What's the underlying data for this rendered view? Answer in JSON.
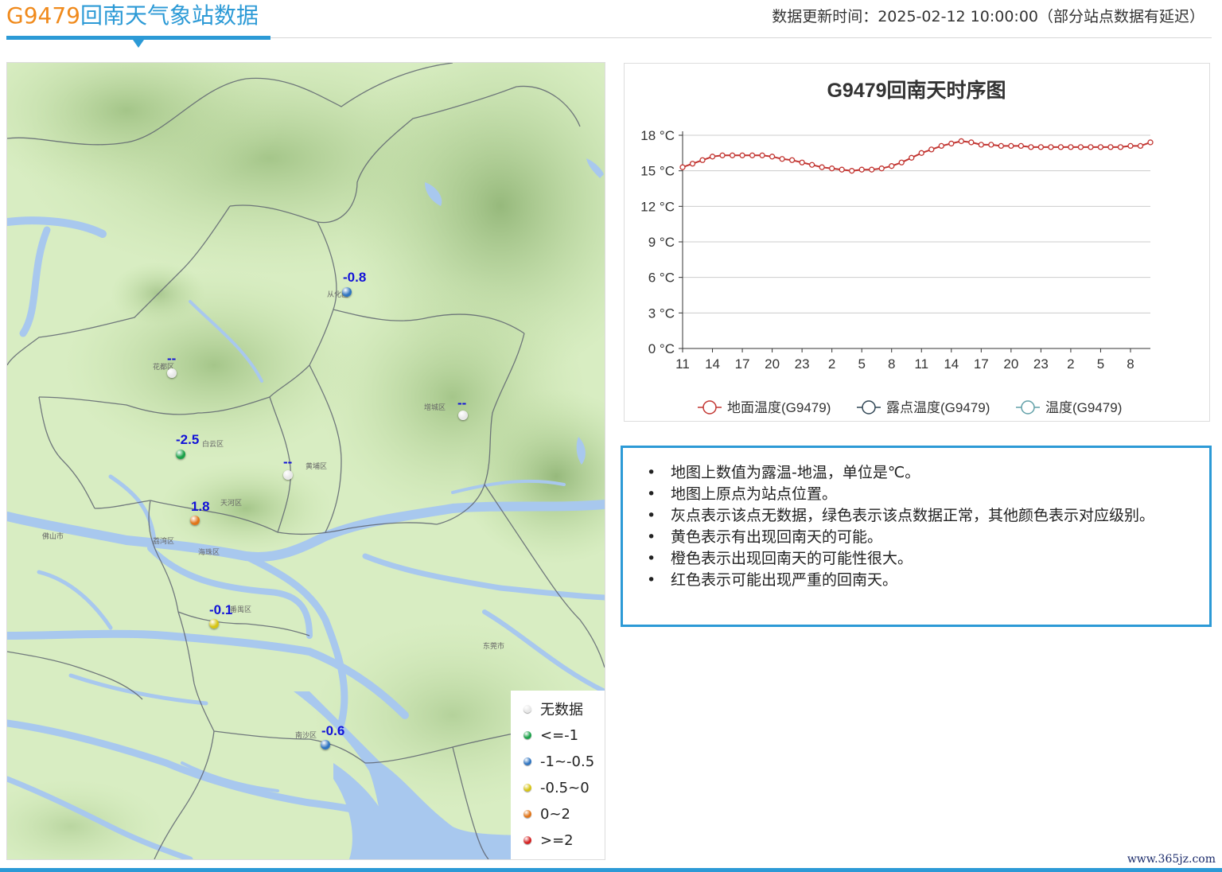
{
  "header": {
    "station_id": "G9479",
    "title_suffix": "回南天气象站数据",
    "update_text": "数据更新时间：2025-02-12 10:00:00（部分站点数据有延迟）"
  },
  "map": {
    "stations": [
      {
        "value": "-0.8",
        "color": "#2f74c0"
      },
      {
        "value": "--",
        "color": "#e8e8e8"
      },
      {
        "value": "--",
        "color": "#e8e8e8"
      },
      {
        "value": "-2.5",
        "color": "#1aa048"
      },
      {
        "value": "--",
        "color": "#e8e8e8"
      },
      {
        "value": "1.8",
        "color": "#e07418"
      },
      {
        "value": "-0.1",
        "color": "#d6c414"
      },
      {
        "value": "-0.6",
        "color": "#2f74c0"
      }
    ],
    "place_labels": [
      "花都区",
      "从化区",
      "白云区",
      "增城区",
      "天河区",
      "番禺区",
      "南沙区",
      "东莞市",
      "佛山市",
      "荔湾区",
      "海珠区",
      "黄埔区"
    ],
    "legend": [
      {
        "label": "无数据",
        "color": "#e8e8e8"
      },
      {
        "label": "<=-1",
        "color": "#1aa048"
      },
      {
        "label": "-1~-0.5",
        "color": "#2f74c0"
      },
      {
        "label": "-0.5~0",
        "color": "#d6c414"
      },
      {
        "label": "0~2",
        "color": "#e07418"
      },
      {
        "label": ">=2",
        "color": "#d42020"
      }
    ]
  },
  "chart_data": {
    "type": "line",
    "title": "G9479回南天时序图",
    "x": [
      "11",
      "12",
      "13",
      "14",
      "15",
      "16",
      "17",
      "18",
      "19",
      "20",
      "21",
      "22",
      "23",
      "0",
      "1",
      "2",
      "3",
      "4",
      "5",
      "6",
      "7",
      "8",
      "9",
      "10",
      "11",
      "12",
      "13",
      "14",
      "15",
      "16",
      "17",
      "18",
      "19",
      "20",
      "21",
      "22",
      "23",
      "0",
      "1",
      "2",
      "3",
      "4",
      "5",
      "6",
      "7",
      "8",
      "9",
      "10"
    ],
    "x_tick_labels": [
      "11",
      "14",
      "17",
      "20",
      "23",
      "2",
      "5",
      "8",
      "11",
      "14",
      "17",
      "20",
      "23",
      "2",
      "5",
      "8"
    ],
    "y_tick_labels": [
      "0 °C",
      "3 °C",
      "6 °C",
      "9 °C",
      "12 °C",
      "15 °C",
      "18 °C"
    ],
    "ylim": [
      0,
      18
    ],
    "grid": true,
    "legend_position": "bottom",
    "series": [
      {
        "name": "地面温度(G9479)",
        "color": "#c23531",
        "values": [
          15.3,
          15.6,
          15.9,
          16.2,
          16.3,
          16.3,
          16.3,
          16.3,
          16.3,
          16.2,
          16.0,
          15.9,
          15.7,
          15.5,
          15.3,
          15.2,
          15.1,
          15.0,
          15.1,
          15.1,
          15.2,
          15.4,
          15.7,
          16.1,
          16.5,
          16.8,
          17.1,
          17.3,
          17.5,
          17.4,
          17.2,
          17.2,
          17.1,
          17.1,
          17.1,
          17.0,
          17.0,
          17.0,
          17.0,
          17.0,
          17.0,
          17.0,
          17.0,
          17.0,
          17.0,
          17.1,
          17.1,
          17.4
        ]
      },
      {
        "name": "露点温度(G9479)",
        "color": "#2f4554",
        "values": []
      },
      {
        "name": "温度(G9479)",
        "color": "#61a0a8",
        "values": []
      }
    ]
  },
  "notes": [
    "地图上数值为露温-地温，单位是℃。",
    "地图上原点为站点位置。",
    "灰点表示该点无数据，绿色表示该点数据正常，其他颜色表示对应级别。",
    "黄色表示有出现回南天的可能。",
    "橙色表示出现回南天的可能性很大。",
    "红色表示可能出现严重的回南天。"
  ],
  "watermark": "www.365jz.com"
}
